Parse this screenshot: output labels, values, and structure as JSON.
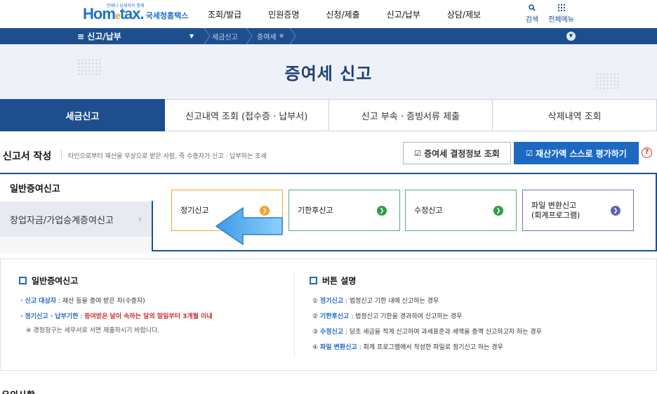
{
  "header": {
    "logo_tiny": "언제나 납세자와 함께",
    "logo_brand_a": "Hom",
    "logo_brand_e": "e",
    "logo_brand_b": "tax.",
    "logo_sub": "국세청홈택스",
    "nav": [
      "조회/발급",
      "민원증명",
      "신청/제출",
      "신고/납부",
      "상담/제보"
    ],
    "search_label": "검색",
    "allmenu_label": "전체메뉴"
  },
  "breadcrumb": {
    "menu_label": "≡ 신고/납부",
    "items": [
      "세금신고",
      "증여세"
    ]
  },
  "banner": {
    "title": "증여세 신고"
  },
  "tabs": [
    "세금신고",
    "신고내역 조회 (접수증 · 납부서)",
    "신고 부속 · 증빙서류 제출",
    "삭제내역 조회"
  ],
  "section": {
    "title": "신고서 작성",
    "desc": "타인으로부터 재산을 무상으로 받은 사람, 즉 수증자가 신고 · 납부하는 조세",
    "btn_view": "증여세 결정정보 조회",
    "btn_eval": "재산가액 스스로 평가하기",
    "help": "?"
  },
  "side_tabs": [
    "일반증여신고",
    "창업자금/가업승계증여신고"
  ],
  "options": [
    {
      "label": "정기신고",
      "color": "#f3a32b"
    },
    {
      "label": "기한후신고",
      "color": "#2e9e4a"
    },
    {
      "label": "수정신고",
      "color": "#2e9e4a"
    },
    {
      "label": "파일 변환신고\n(회계프로그램)",
      "color": "#5d62b3"
    }
  ],
  "info_left": {
    "title": "일반증여신고",
    "l1_key": "· 신고 대상자",
    "l1_val": " : 재산 등을 증여 받은 자(수증자)",
    "l2_key": "· 정기신고 · 납부기한",
    "l2_sep": " : ",
    "l2_val": "증여받은 날이 속하는 달의 말일부터 3개월 이내",
    "l3": "※ 경정청구는 세무서로 서면 제출하시기 바랍니다."
  },
  "info_right": {
    "title": "버튼 설명",
    "items": [
      {
        "num": "① ",
        "key": "정기신고",
        "val": " : 법정신고 기한 내에 신고하는 경우"
      },
      {
        "num": "② ",
        "key": "기한후신고",
        "val": " : 법정신고 기한을 경과하여 신고하는 경우"
      },
      {
        "num": "③ ",
        "key": "수정신고",
        "val": " : 당초 세금을 적게 신고하여 과세표준과 세액을 증액 신고하고자 하는 경우"
      },
      {
        "num": "④ ",
        "key": "파일 변환신고",
        "val": " : 회계 프로그램에서 작성한 파일로 정기신고 하는 경우"
      }
    ]
  },
  "notice": {
    "title": "유의사항"
  }
}
